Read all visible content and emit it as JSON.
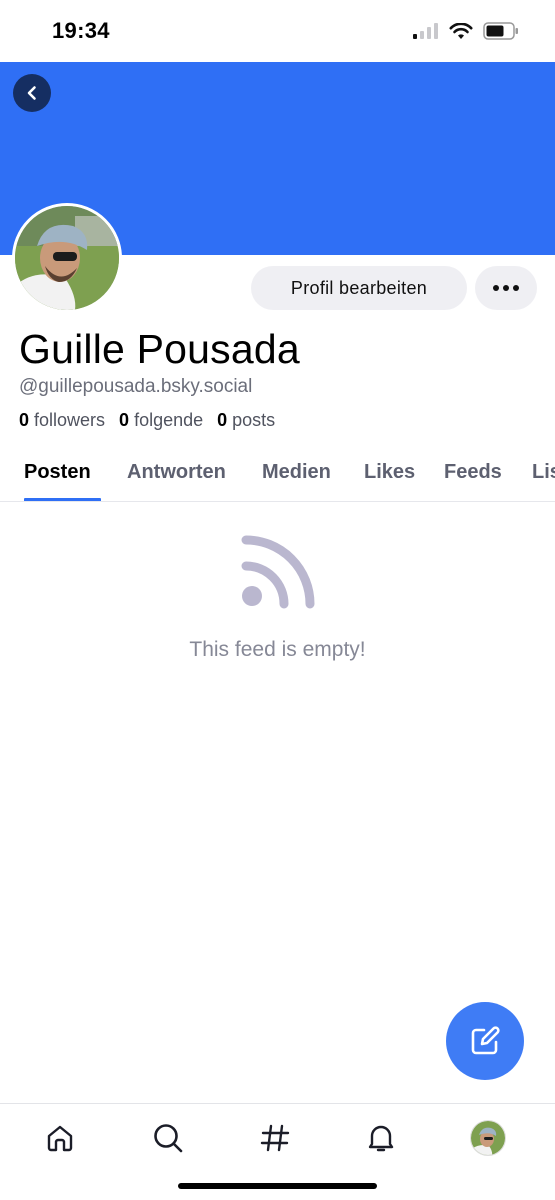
{
  "status_bar": {
    "time": "19:34"
  },
  "profile": {
    "display_name": "Guille Pousada",
    "handle": "@guillepousada.bsky.social",
    "banner_color": "#2f6ff5",
    "stats": {
      "followers_count": "0",
      "followers_label": "followers",
      "following_count": "0",
      "following_label": "folgende",
      "posts_count": "0",
      "posts_label": "posts"
    }
  },
  "actions": {
    "edit_profile_label": "Profil bearbeiten",
    "more_icon": "more-horizontal-icon",
    "back_icon": "chevron-left-icon"
  },
  "tabs": [
    {
      "label": "Posten",
      "active": true
    },
    {
      "label": "Antworten",
      "active": false
    },
    {
      "label": "Medien",
      "active": false
    },
    {
      "label": "Likes",
      "active": false
    },
    {
      "label": "Feeds",
      "active": false
    },
    {
      "label": "Lists",
      "active": false
    }
  ],
  "feed": {
    "empty_message": "This feed is empty!",
    "empty_icon": "rss-feed-icon"
  },
  "fab": {
    "icon": "compose-icon",
    "color": "#3f7cf5"
  },
  "bottom_nav": [
    {
      "name": "home",
      "icon": "home-icon"
    },
    {
      "name": "search",
      "icon": "search-icon"
    },
    {
      "name": "feeds",
      "icon": "hashtag-icon"
    },
    {
      "name": "notifications",
      "icon": "bell-icon"
    },
    {
      "name": "profile",
      "icon": "avatar"
    }
  ],
  "colors": {
    "accent": "#2f6ff5",
    "muted_text": "#6b6e7a",
    "icon_muted": "#bab7cf"
  }
}
